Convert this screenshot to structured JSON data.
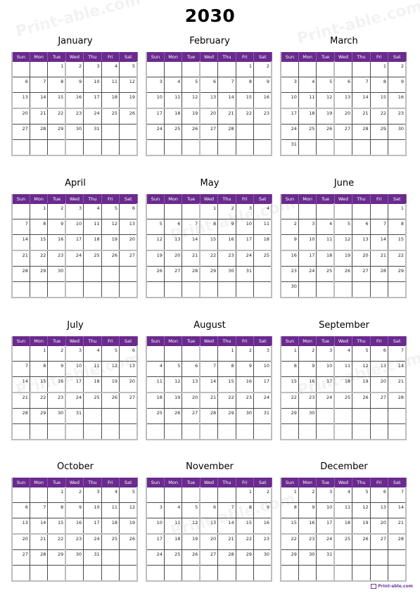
{
  "year": "2030",
  "weekdays": [
    "Sun",
    "Mon",
    "Tue",
    "Wed",
    "Thu",
    "Fri",
    "Sat"
  ],
  "watermark_text": "Print-able.com",
  "footer_logo": "Print-able.com",
  "accent_color": "#6a2a8e",
  "months": [
    {
      "name": "January",
      "weeks": [
        [
          "",
          "",
          "1",
          "2",
          "3",
          "4",
          "5"
        ],
        [
          "6",
          "7",
          "8",
          "9",
          "10",
          "11",
          "12"
        ],
        [
          "13",
          "14",
          "15",
          "16",
          "17",
          "18",
          "19"
        ],
        [
          "20",
          "21",
          "22",
          "23",
          "24",
          "25",
          "26"
        ],
        [
          "27",
          "28",
          "29",
          "30",
          "31",
          "",
          ""
        ],
        [
          "",
          "",
          "",
          "",
          "",
          "",
          ""
        ]
      ]
    },
    {
      "name": "February",
      "weeks": [
        [
          "",
          "",
          "",
          "",
          "",
          "1",
          "2"
        ],
        [
          "3",
          "4",
          "5",
          "6",
          "7",
          "8",
          "9"
        ],
        [
          "10",
          "11",
          "12",
          "13",
          "14",
          "15",
          "16"
        ],
        [
          "17",
          "18",
          "19",
          "20",
          "21",
          "22",
          "23"
        ],
        [
          "24",
          "25",
          "26",
          "27",
          "28",
          "",
          ""
        ],
        [
          "",
          "",
          "",
          "",
          "",
          "",
          ""
        ]
      ]
    },
    {
      "name": "March",
      "weeks": [
        [
          "",
          "",
          "",
          "",
          "",
          "1",
          "2"
        ],
        [
          "3",
          "4",
          "5",
          "6",
          "7",
          "8",
          "9"
        ],
        [
          "10",
          "11",
          "12",
          "13",
          "14",
          "15",
          "16"
        ],
        [
          "17",
          "18",
          "19",
          "20",
          "21",
          "22",
          "23"
        ],
        [
          "24",
          "25",
          "26",
          "27",
          "28",
          "29",
          "30"
        ],
        [
          "31",
          "",
          "",
          "",
          "",
          "",
          ""
        ]
      ]
    },
    {
      "name": "April",
      "weeks": [
        [
          "",
          "1",
          "2",
          "3",
          "4",
          "5",
          "6"
        ],
        [
          "7",
          "8",
          "9",
          "10",
          "11",
          "12",
          "13"
        ],
        [
          "14",
          "15",
          "16",
          "17",
          "18",
          "19",
          "20"
        ],
        [
          "21",
          "22",
          "23",
          "24",
          "25",
          "26",
          "27"
        ],
        [
          "28",
          "29",
          "30",
          "",
          "",
          "",
          ""
        ],
        [
          "",
          "",
          "",
          "",
          "",
          "",
          ""
        ]
      ]
    },
    {
      "name": "May",
      "weeks": [
        [
          "",
          "",
          "",
          "1",
          "2",
          "3",
          "4"
        ],
        [
          "5",
          "6",
          "7",
          "8",
          "9",
          "10",
          "11"
        ],
        [
          "12",
          "13",
          "14",
          "15",
          "16",
          "17",
          "18"
        ],
        [
          "19",
          "20",
          "21",
          "22",
          "23",
          "24",
          "25"
        ],
        [
          "26",
          "27",
          "28",
          "29",
          "30",
          "31",
          ""
        ],
        [
          "",
          "",
          "",
          "",
          "",
          "",
          ""
        ]
      ]
    },
    {
      "name": "June",
      "weeks": [
        [
          "",
          "",
          "",
          "",
          "",
          "",
          "1"
        ],
        [
          "2",
          "3",
          "4",
          "5",
          "6",
          "7",
          "8"
        ],
        [
          "9",
          "10",
          "11",
          "12",
          "13",
          "14",
          "15"
        ],
        [
          "16",
          "17",
          "18",
          "19",
          "20",
          "21",
          "22"
        ],
        [
          "23",
          "24",
          "25",
          "26",
          "27",
          "28",
          "29"
        ],
        [
          "30",
          "",
          "",
          "",
          "",
          "",
          ""
        ]
      ]
    },
    {
      "name": "July",
      "weeks": [
        [
          "",
          "1",
          "2",
          "3",
          "4",
          "5",
          "6"
        ],
        [
          "7",
          "8",
          "9",
          "10",
          "11",
          "12",
          "13"
        ],
        [
          "14",
          "15",
          "16",
          "17",
          "18",
          "19",
          "20"
        ],
        [
          "21",
          "22",
          "23",
          "24",
          "25",
          "26",
          "27"
        ],
        [
          "28",
          "29",
          "30",
          "31",
          "",
          "",
          ""
        ],
        [
          "",
          "",
          "",
          "",
          "",
          "",
          ""
        ]
      ]
    },
    {
      "name": "August",
      "weeks": [
        [
          "",
          "",
          "",
          "",
          "1",
          "2",
          "3"
        ],
        [
          "4",
          "5",
          "6",
          "7",
          "8",
          "9",
          "10"
        ],
        [
          "11",
          "12",
          "13",
          "14",
          "15",
          "16",
          "17"
        ],
        [
          "18",
          "19",
          "20",
          "21",
          "22",
          "23",
          "24"
        ],
        [
          "25",
          "26",
          "27",
          "28",
          "29",
          "30",
          "31"
        ],
        [
          "",
          "",
          "",
          "",
          "",
          "",
          ""
        ]
      ]
    },
    {
      "name": "September",
      "weeks": [
        [
          "1",
          "2",
          "3",
          "4",
          "5",
          "6",
          "7"
        ],
        [
          "8",
          "9",
          "10",
          "11",
          "12",
          "13",
          "14"
        ],
        [
          "15",
          "16",
          "17",
          "18",
          "19",
          "20",
          "21"
        ],
        [
          "22",
          "23",
          "24",
          "25",
          "26",
          "27",
          "28"
        ],
        [
          "29",
          "30",
          "",
          "",
          "",
          "",
          ""
        ],
        [
          "",
          "",
          "",
          "",
          "",
          "",
          ""
        ]
      ]
    },
    {
      "name": "October",
      "weeks": [
        [
          "",
          "",
          "1",
          "2",
          "3",
          "4",
          "5"
        ],
        [
          "6",
          "7",
          "8",
          "9",
          "10",
          "11",
          "12"
        ],
        [
          "13",
          "14",
          "15",
          "16",
          "17",
          "18",
          "19"
        ],
        [
          "20",
          "21",
          "22",
          "23",
          "24",
          "25",
          "26"
        ],
        [
          "27",
          "28",
          "29",
          "30",
          "31",
          "",
          ""
        ],
        [
          "",
          "",
          "",
          "",
          "",
          "",
          ""
        ]
      ]
    },
    {
      "name": "November",
      "weeks": [
        [
          "",
          "",
          "",
          "",
          "",
          "1",
          "2"
        ],
        [
          "3",
          "4",
          "5",
          "6",
          "7",
          "8",
          "9"
        ],
        [
          "10",
          "11",
          "12",
          "13",
          "14",
          "15",
          "16"
        ],
        [
          "17",
          "18",
          "19",
          "20",
          "21",
          "22",
          "23"
        ],
        [
          "24",
          "25",
          "26",
          "27",
          "28",
          "29",
          "30"
        ],
        [
          "",
          "",
          "",
          "",
          "",
          "",
          ""
        ]
      ]
    },
    {
      "name": "December",
      "weeks": [
        [
          "1",
          "2",
          "3",
          "4",
          "5",
          "6",
          "7"
        ],
        [
          "8",
          "9",
          "10",
          "11",
          "12",
          "13",
          "14"
        ],
        [
          "15",
          "16",
          "17",
          "18",
          "19",
          "20",
          "21"
        ],
        [
          "22",
          "23",
          "24",
          "25",
          "26",
          "27",
          "28"
        ],
        [
          "29",
          "30",
          "31",
          "",
          "",
          "",
          ""
        ],
        [
          "",
          "",
          "",
          "",
          "",
          "",
          ""
        ]
      ]
    }
  ]
}
